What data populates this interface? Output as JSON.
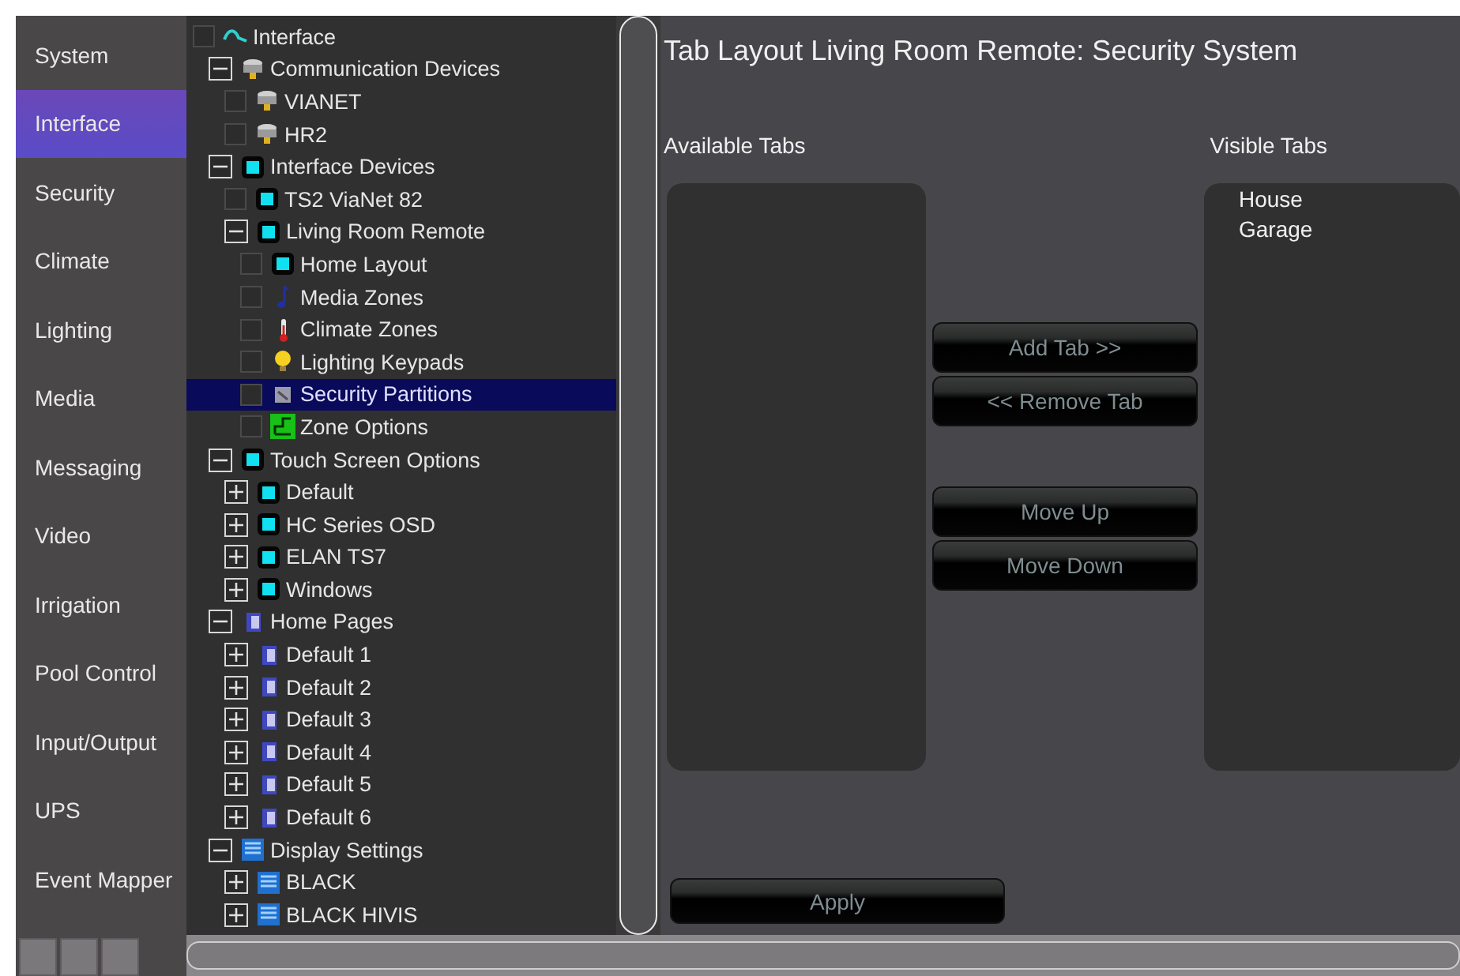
{
  "sidebar": {
    "items": [
      {
        "label": "System",
        "selected": false
      },
      {
        "label": "Interface",
        "selected": true
      },
      {
        "label": "Security",
        "selected": false
      },
      {
        "label": "Climate",
        "selected": false
      },
      {
        "label": "Lighting",
        "selected": false
      },
      {
        "label": "Media",
        "selected": false
      },
      {
        "label": "Messaging",
        "selected": false
      },
      {
        "label": "Video",
        "selected": false
      },
      {
        "label": "Irrigation",
        "selected": false
      },
      {
        "label": "Pool Control",
        "selected": false
      },
      {
        "label": "Input/Output",
        "selected": false
      },
      {
        "label": "UPS",
        "selected": false
      },
      {
        "label": "Event Mapper",
        "selected": false
      }
    ]
  },
  "tree": [
    {
      "label": "Interface",
      "kind": "cable",
      "checked": false,
      "selected": false,
      "children": [
        {
          "label": "Communication Devices",
          "kind": "device",
          "expanded": true,
          "selected": false,
          "children": [
            {
              "label": "VIANET",
              "kind": "device",
              "checked": false,
              "selected": false
            },
            {
              "label": "HR2",
              "kind": "device",
              "checked": false,
              "selected": false
            }
          ]
        },
        {
          "label": "Interface Devices",
          "kind": "screen",
          "expanded": true,
          "selected": false,
          "children": [
            {
              "label": "TS2 ViaNet 82",
              "kind": "screen",
              "checked": false,
              "selected": false
            },
            {
              "label": "Living Room Remote",
              "kind": "screen",
              "expanded": true,
              "selected": false,
              "children": [
                {
                  "label": "Home Layout",
                  "kind": "screen",
                  "checked": false,
                  "selected": false
                },
                {
                  "label": "Media Zones",
                  "kind": "note",
                  "checked": false,
                  "selected": false
                },
                {
                  "label": "Climate Zones",
                  "kind": "thermometer",
                  "checked": false,
                  "selected": false
                },
                {
                  "label": "Lighting Keypads",
                  "kind": "bulb",
                  "checked": false,
                  "selected": false
                },
                {
                  "label": "Security Partitions",
                  "kind": "panel",
                  "checked": false,
                  "selected": true
                },
                {
                  "label": "Zone Options",
                  "kind": "zone",
                  "checked": false,
                  "selected": false
                }
              ]
            }
          ]
        },
        {
          "label": "Touch Screen Options",
          "kind": "screen",
          "expanded": true,
          "selected": false,
          "children": [
            {
              "label": "Default",
              "kind": "screen",
              "expanded": false,
              "selected": false
            },
            {
              "label": "HC Series OSD",
              "kind": "screen",
              "expanded": false,
              "selected": false
            },
            {
              "label": "ELAN TS7",
              "kind": "screen",
              "expanded": false,
              "selected": false
            },
            {
              "label": "Windows",
              "kind": "screen",
              "expanded": false,
              "selected": false
            }
          ]
        },
        {
          "label": "Home Pages",
          "kind": "page",
          "expanded": true,
          "selected": false,
          "children": [
            {
              "label": "Default 1",
              "kind": "page",
              "expanded": false,
              "selected": false
            },
            {
              "label": "Default 2",
              "kind": "page",
              "expanded": false,
              "selected": false
            },
            {
              "label": "Default 3",
              "kind": "page",
              "expanded": false,
              "selected": false
            },
            {
              "label": "Default 4",
              "kind": "page",
              "expanded": false,
              "selected": false
            },
            {
              "label": "Default 5",
              "kind": "page",
              "expanded": false,
              "selected": false
            },
            {
              "label": "Default 6",
              "kind": "page",
              "expanded": false,
              "selected": false
            }
          ]
        },
        {
          "label": "Display Settings",
          "kind": "display",
          "expanded": true,
          "selected": false,
          "children": [
            {
              "label": "BLACK",
              "kind": "display",
              "expanded": false,
              "selected": false
            },
            {
              "label": "BLACK HIVIS",
              "kind": "display",
              "expanded": false,
              "selected": false
            }
          ]
        }
      ]
    }
  ],
  "panel": {
    "title": "Tab Layout Living Room Remote: Security System",
    "available": {
      "label": "Available Tabs"
    },
    "visible": {
      "label": "Visible Tabs",
      "items": [
        "House",
        "Garage"
      ]
    },
    "buttons": [
      {
        "label": "Add Tab >>",
        "disabled": true
      },
      {
        "label": "<< Remove Tab",
        "disabled": true
      },
      {
        "label": "Move Up",
        "disabled": true
      },
      {
        "label": "Move Down",
        "disabled": true
      }
    ],
    "apply": {
      "label": "Apply",
      "disabled": true
    }
  }
}
